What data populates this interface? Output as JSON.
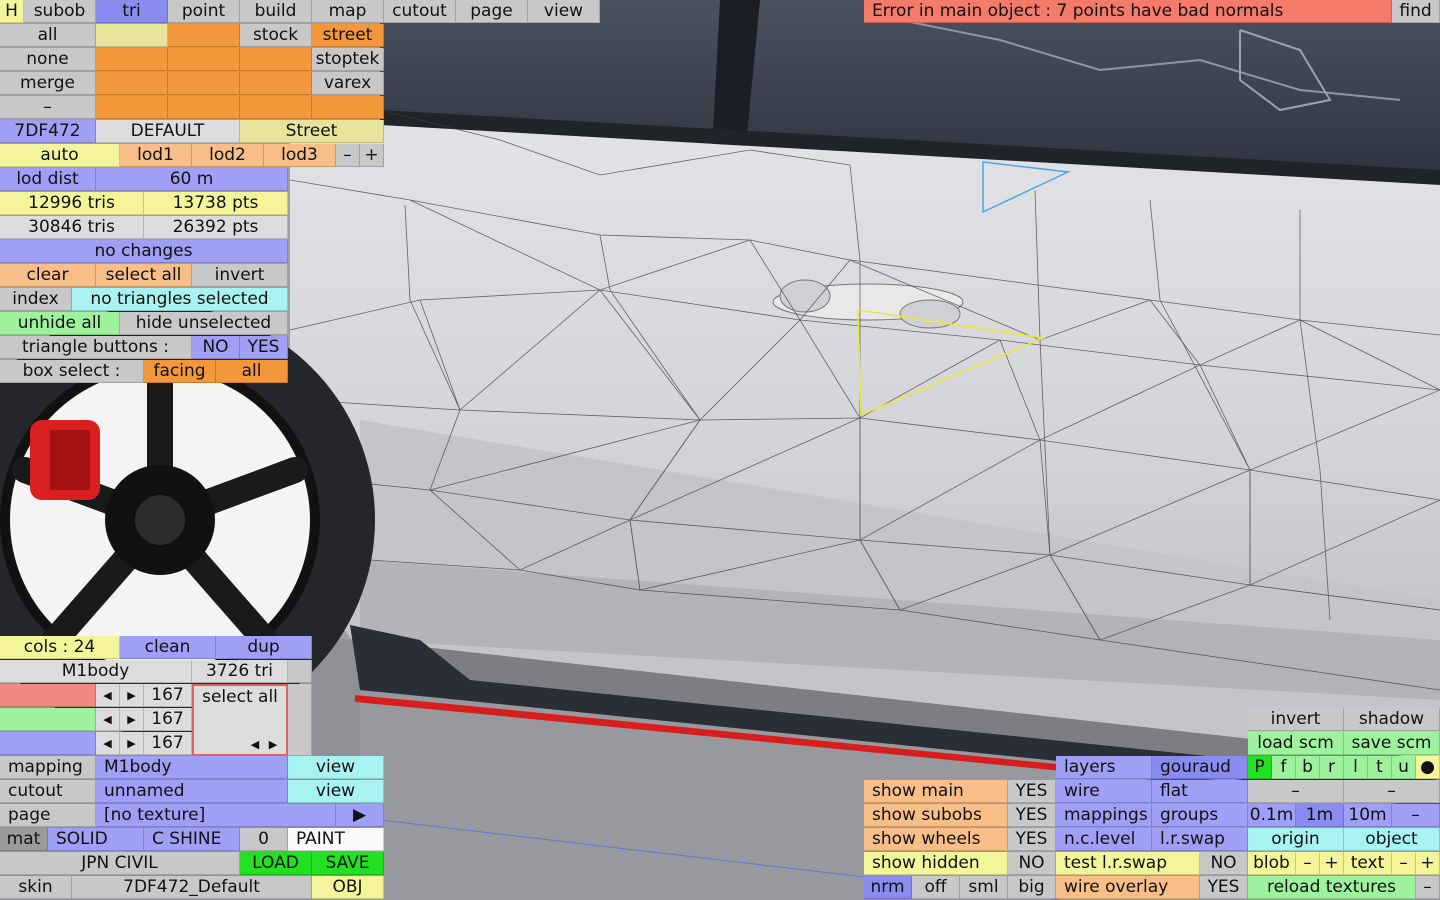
{
  "top_tabs": [
    "H",
    "subob",
    "tri",
    "point",
    "build",
    "map",
    "cutout",
    "page",
    "view"
  ],
  "error_message": "Error in main object : 7 points have bad normals",
  "find_label": "find",
  "select_rows": {
    "all": "all",
    "none": "none",
    "merge": "merge",
    "dash": "–",
    "stock": "stock",
    "street": "street",
    "stoptek": "stoptek",
    "varex": "varex"
  },
  "config": {
    "color_code": "7DF472",
    "default": "DEFAULT",
    "variant": "Street"
  },
  "lod": {
    "auto": "auto",
    "lod1": "lod1",
    "lod2": "lod2",
    "lod3": "lod3",
    "minus": "–",
    "plus": "+",
    "dist_label": "lod dist",
    "dist_value": "60 m"
  },
  "stats": {
    "tris_a": "12996 tris",
    "pts_a": "13738 pts",
    "tris_b": "30846 tris",
    "pts_b": "26392 pts"
  },
  "status": "no changes",
  "selection": {
    "clear": "clear",
    "select_all": "select all",
    "invert": "invert",
    "index": "index",
    "none_selected": "no triangles selected",
    "unhide_all": "unhide all",
    "hide_unselected": "hide unselected",
    "tri_buttons_label": "triangle buttons :",
    "no": "NO",
    "yes": "YES",
    "box_select_label": "box select :",
    "facing": "facing",
    "all": "all"
  },
  "material": {
    "cols": "cols : 24",
    "clean": "clean",
    "dup": "dup",
    "name": "M1body",
    "tri_count": "3726 tri",
    "rows": [
      {
        "value": "167"
      },
      {
        "value": "167"
      },
      {
        "value": "167"
      }
    ],
    "select_all": "select all"
  },
  "mapping": {
    "mapping_label": "mapping",
    "mapping_value": "M1body",
    "view1": "view",
    "cutout_label": "cutout",
    "cutout_value": "unnamed",
    "view2": "view",
    "page_label": "page",
    "page_value": "[no texture]",
    "play": "▶",
    "mat_label": "mat",
    "solid": "SOLID",
    "shine": "C SHINE",
    "zero": "0",
    "paint": "PAINT",
    "preset": "JPN CIVIL",
    "load": "LOAD",
    "save": "SAVE",
    "skin_label": "skin",
    "skin_value": "7DF472_Default",
    "obj": "OBJ"
  },
  "display": {
    "show_main": "show main",
    "show_main_v": "YES",
    "show_subobs": "show subobs",
    "show_subobs_v": "YES",
    "show_wheels": "show wheels",
    "show_wheels_v": "YES",
    "show_hidden": "show hidden",
    "show_hidden_v": "NO",
    "nrm": "nrm",
    "off": "off",
    "sml": "sml",
    "big": "big"
  },
  "render": {
    "layers": "layers",
    "gouraud": "gouraud",
    "wire": "wire",
    "flat": "flat",
    "mappings": "mappings",
    "groups": "groups",
    "nclevel": "n.c.level",
    "lrswap": "l.r.swap",
    "test_lrswap": "test l.r.swap",
    "test_lrswap_v": "NO",
    "wire_overlay": "wire overlay",
    "wire_overlay_v": "YES"
  },
  "right": {
    "invert": "invert",
    "shadow": "shadow",
    "load_scm": "load scm",
    "save_scm": "save scm",
    "letters": [
      "P",
      "f",
      "b",
      "r",
      "l",
      "t",
      "u",
      "●"
    ],
    "dash1": "–",
    "dash2": "–",
    "s01": "0.1m",
    "s1": "1m",
    "s10": "10m",
    "sdash": "–",
    "origin": "origin",
    "object": "object",
    "blob": "blob",
    "blob_minus": "–",
    "blob_plus": "+",
    "text": "text",
    "text_minus": "–",
    "text_plus": "+",
    "reload": "reload textures",
    "rdash": "–"
  }
}
